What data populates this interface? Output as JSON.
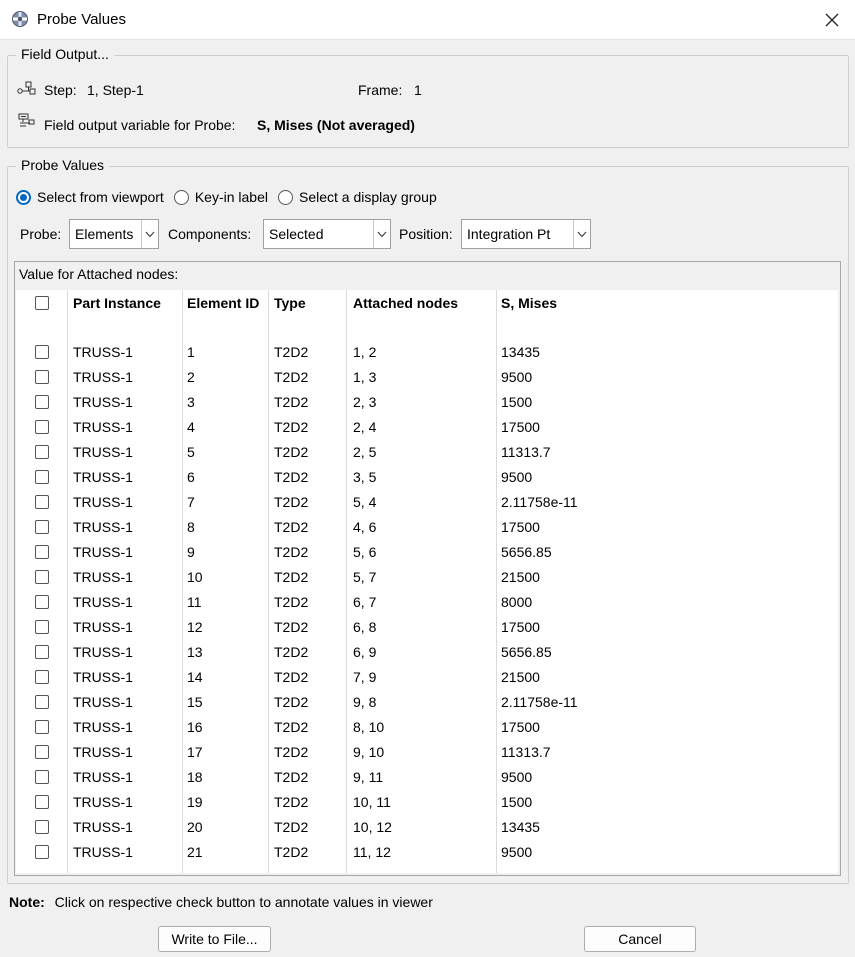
{
  "window": {
    "title": "Probe Values",
    "icon": "probe-app-icon",
    "close_icon": "close-icon"
  },
  "field_output": {
    "group_title": "Field Output...",
    "step_label": "Step:",
    "step_value": "1, Step-1",
    "frame_label": "Frame:",
    "frame_value": "1",
    "variable_label": "Field output variable for Probe:",
    "variable_value": "S, Mises (Not averaged)"
  },
  "probe_values": {
    "group_title": "Probe Values",
    "radios": [
      {
        "label": "Select from viewport",
        "checked": true
      },
      {
        "label": "Key-in label",
        "checked": false
      },
      {
        "label": "Select a display group",
        "checked": false
      }
    ],
    "probe_label": "Probe:",
    "probe_value": "Elements",
    "components_label": "Components:",
    "components_value": "Selected",
    "position_label": "Position:",
    "position_value": "Integration Pt"
  },
  "table": {
    "caption": "Value for Attached nodes:",
    "columns": [
      "Part Instance",
      "Element ID",
      "Type",
      "Attached nodes",
      "S, Mises"
    ],
    "rows": [
      [
        "TRUSS-1",
        "1",
        "T2D2",
        "1, 2",
        "13435"
      ],
      [
        "TRUSS-1",
        "2",
        "T2D2",
        "1, 3",
        "9500"
      ],
      [
        "TRUSS-1",
        "3",
        "T2D2",
        "2, 3",
        "1500"
      ],
      [
        "TRUSS-1",
        "4",
        "T2D2",
        "2, 4",
        "17500"
      ],
      [
        "TRUSS-1",
        "5",
        "T2D2",
        "2, 5",
        "11313.7"
      ],
      [
        "TRUSS-1",
        "6",
        "T2D2",
        "3, 5",
        "9500"
      ],
      [
        "TRUSS-1",
        "7",
        "T2D2",
        "5, 4",
        "2.11758e-11"
      ],
      [
        "TRUSS-1",
        "8",
        "T2D2",
        "4, 6",
        "17500"
      ],
      [
        "TRUSS-1",
        "9",
        "T2D2",
        "5, 6",
        "5656.85"
      ],
      [
        "TRUSS-1",
        "10",
        "T2D2",
        "5, 7",
        "21500"
      ],
      [
        "TRUSS-1",
        "11",
        "T2D2",
        "6, 7",
        "8000"
      ],
      [
        "TRUSS-1",
        "12",
        "T2D2",
        "6, 8",
        "17500"
      ],
      [
        "TRUSS-1",
        "13",
        "T2D2",
        "6, 9",
        "5656.85"
      ],
      [
        "TRUSS-1",
        "14",
        "T2D2",
        "7, 9",
        "21500"
      ],
      [
        "TRUSS-1",
        "15",
        "T2D2",
        "9, 8",
        "2.11758e-11"
      ],
      [
        "TRUSS-1",
        "16",
        "T2D2",
        "8, 10",
        "17500"
      ],
      [
        "TRUSS-1",
        "17",
        "T2D2",
        "9, 10",
        "11313.7"
      ],
      [
        "TRUSS-1",
        "18",
        "T2D2",
        "9, 11",
        "9500"
      ],
      [
        "TRUSS-1",
        "19",
        "T2D2",
        "10, 11",
        "1500"
      ],
      [
        "TRUSS-1",
        "20",
        "T2D2",
        "10, 12",
        "13435"
      ],
      [
        "TRUSS-1",
        "21",
        "T2D2",
        "11, 12",
        "9500"
      ]
    ]
  },
  "footer": {
    "note_label": "Note:",
    "note_text": "Click on respective check button to annotate values in viewer",
    "write_button": "Write to File...",
    "cancel_button": "Cancel"
  },
  "colors": {
    "accent": "#0067c0",
    "background": "#f0f0f0"
  }
}
